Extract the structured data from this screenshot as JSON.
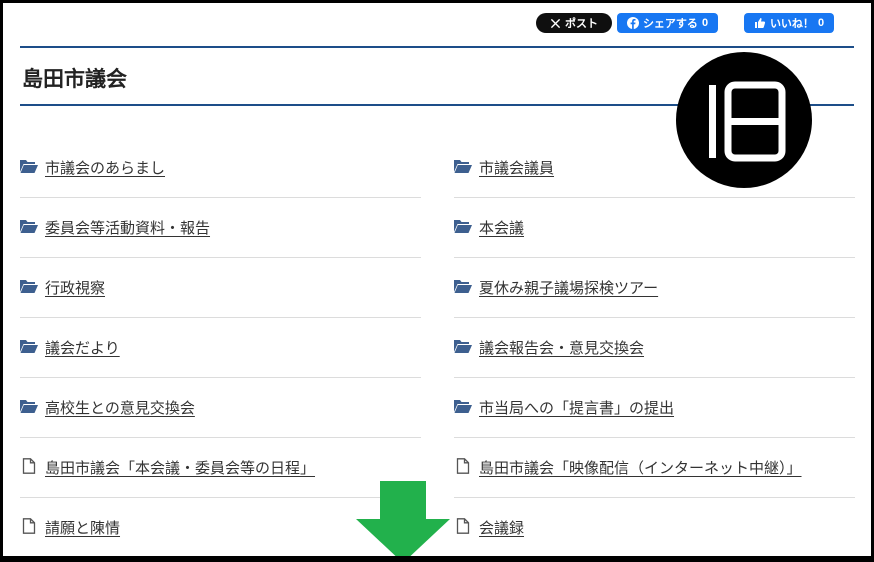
{
  "social": {
    "x_label": "ポスト",
    "fb_label": "シェアする",
    "fb_count": "0",
    "like_label": "いいね！",
    "like_count": "0"
  },
  "page": {
    "title": "島田市議会"
  },
  "badge": {
    "icon": "old-version-badge-icon"
  },
  "links": {
    "left": [
      {
        "label": "市議会のあらまし",
        "icon": "folder-icon"
      },
      {
        "label": "委員会等活動資料・報告",
        "icon": "folder-icon"
      },
      {
        "label": "行政視察",
        "icon": "folder-icon"
      },
      {
        "label": "議会だより",
        "icon": "folder-icon"
      },
      {
        "label": "高校生との意見交換会",
        "icon": "folder-icon"
      },
      {
        "label": "島田市議会「本会議・委員会等の日程」",
        "icon": "document-icon"
      },
      {
        "label": "請願と陳情",
        "icon": "document-icon"
      }
    ],
    "right": [
      {
        "label": "市議会議員",
        "icon": "folder-icon"
      },
      {
        "label": "本会議",
        "icon": "folder-icon"
      },
      {
        "label": "夏休み親子議場探検ツアー",
        "icon": "folder-icon"
      },
      {
        "label": "議会報告会・意見交換会",
        "icon": "folder-icon"
      },
      {
        "label": "市当局への「提言書」の提出",
        "icon": "folder-icon"
      },
      {
        "label": "島田市議会「映像配信（インターネット中継）」",
        "icon": "document-icon"
      },
      {
        "label": "会議録",
        "icon": "document-icon"
      }
    ]
  },
  "colors": {
    "accent": "#1d4e89",
    "folder_icon": "#3d5f8f",
    "facebook": "#1877f2",
    "arrow": "#22b14c"
  }
}
